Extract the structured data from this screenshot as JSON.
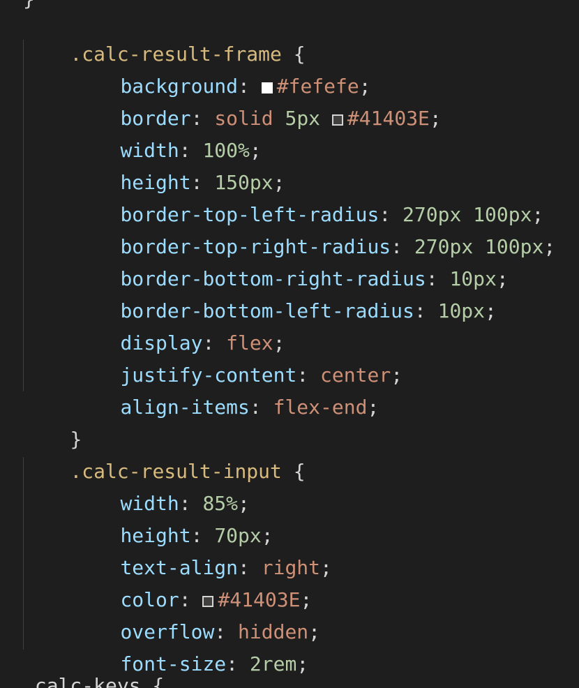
{
  "partial_top": "}",
  "partial_bottom": ".calc-keys {",
  "rules": [
    {
      "selector": ".calc-result-frame",
      "open_brace": "{",
      "close_brace": "}",
      "declarations": [
        {
          "property": "background",
          "colon": ":",
          "swatch": "#fefefe",
          "value": "#fefefe",
          "semi": ";"
        },
        {
          "property": "border",
          "colon": ":",
          "value_pre": "solid ",
          "value_num": "5px",
          "swatch": "#41403E",
          "value": "#41403E",
          "semi": ";"
        },
        {
          "property": "width",
          "colon": ":",
          "value_num": "100%",
          "semi": ";"
        },
        {
          "property": "height",
          "colon": ":",
          "value_num": "150px",
          "semi": ";"
        },
        {
          "property": "border-top-left-radius",
          "colon": ":",
          "value_num": "270px 100px",
          "semi": ";"
        },
        {
          "property": "border-top-right-radius",
          "colon": ":",
          "value_num": "270px 100px",
          "semi": ";"
        },
        {
          "property": "border-bottom-right-radius",
          "colon": ":",
          "value_num": "10px",
          "semi": ";"
        },
        {
          "property": "border-bottom-left-radius",
          "colon": ":",
          "value_num": "10px",
          "semi": ";"
        },
        {
          "property": "display",
          "colon": ":",
          "value_str": "flex",
          "semi": ";"
        },
        {
          "property": "justify-content",
          "colon": ":",
          "value_str": "center",
          "semi": ";"
        },
        {
          "property": "align-items",
          "colon": ":",
          "value_str": "flex-end",
          "semi": ";"
        }
      ]
    },
    {
      "selector": ".calc-result-input",
      "open_brace": "{",
      "close_brace": "}",
      "declarations": [
        {
          "property": "width",
          "colon": ":",
          "value_num": "85%",
          "semi": ";"
        },
        {
          "property": "height",
          "colon": ":",
          "value_num": "70px",
          "semi": ";"
        },
        {
          "property": "text-align",
          "colon": ":",
          "value_str": "right",
          "semi": ";"
        },
        {
          "property": "color",
          "colon": ":",
          "swatch": "#41403E",
          "value": "#41403E",
          "semi": ";"
        },
        {
          "property": "overflow",
          "colon": ":",
          "value_str": "hidden",
          "semi": ";"
        },
        {
          "property": "font-size",
          "colon": ":",
          "value_num": "2rem",
          "semi": ";"
        }
      ]
    }
  ]
}
